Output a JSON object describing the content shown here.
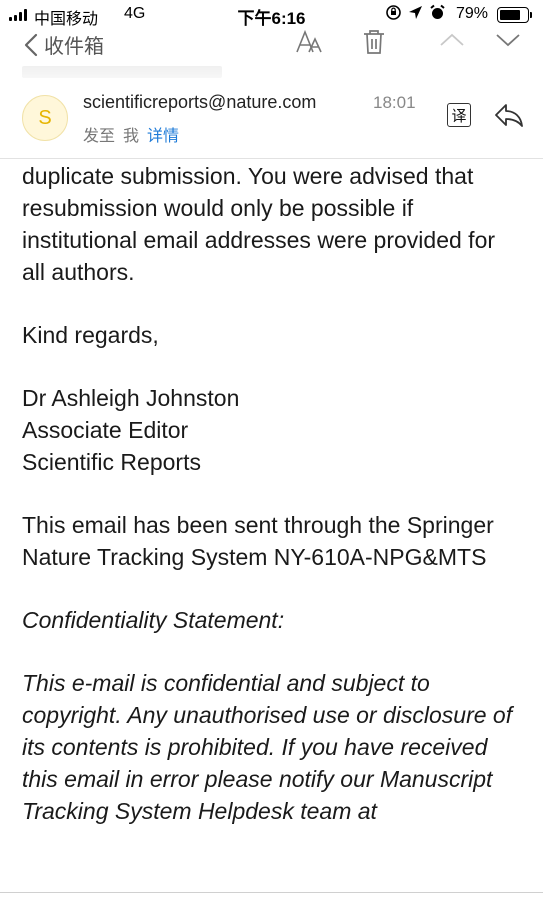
{
  "status_bar": {
    "carrier": "中国移动",
    "network": "4G",
    "time": "下午6:16",
    "battery_percent": "79%",
    "battery_level": 0.79
  },
  "nav": {
    "back_label": "收件箱",
    "icons": [
      "chevron-left-icon",
      "font-size-icon",
      "trash-icon",
      "chevron-up-icon",
      "chevron-down-icon"
    ]
  },
  "email": {
    "avatar_letter": "S",
    "sender": "scientificreports@nature.com",
    "time": "18:01",
    "sent_to_label": "发至",
    "recipient": "我",
    "details_link": "详情",
    "translate_label": "译"
  },
  "body": {
    "paragraph_1": "duplicate submission. You were advised that resubmission would only be possible if institutional email addresses were provided for all authors.",
    "closing": "Kind regards,",
    "signature_name": "Dr Ashleigh Johnston",
    "signature_title": "Associate Editor",
    "signature_journal": "Scientific Reports",
    "tracking_note": "This email has been sent through the Springer Nature Tracking System NY-610A-NPG&MTS",
    "confidentiality_heading": "Confidentiality Statement:",
    "confidentiality_text": "This e-mail is confidential and subject to copyright. Any unauthorised use or disclosure of its contents is prohibited. If you have received this email in error please notify our Manuscript Tracking System Helpdesk team at"
  },
  "colors": {
    "link": "#1e7bd8",
    "avatar_bg": "#fff7da",
    "avatar_text": "#e6b400"
  }
}
